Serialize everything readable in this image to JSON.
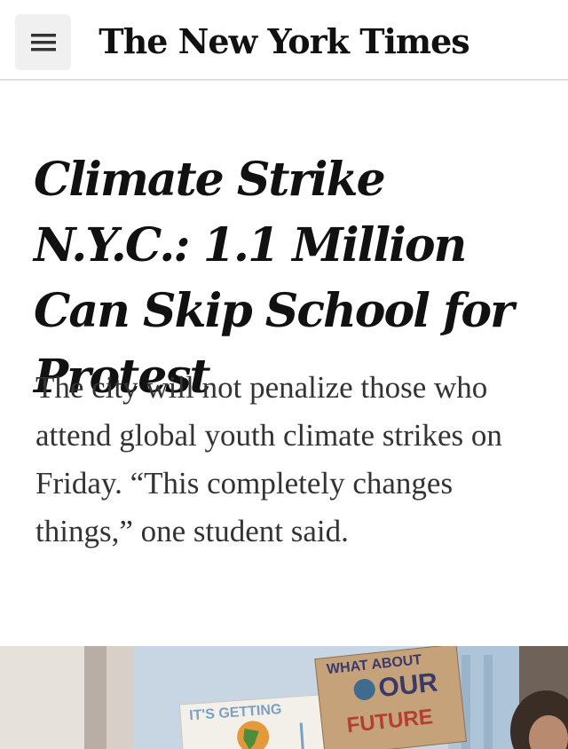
{
  "header": {
    "menu_icon": "hamburger-menu-icon",
    "masthead": "The New York Times"
  },
  "article": {
    "headline": "Climate Strike N.Y.C.: 1.1 Million Can Skip School for Protest",
    "summary": "The city will not penalize those who attend global youth climate strikes on Friday. “This completely changes things,” one student said."
  },
  "photo": {
    "sign_left": "IT'S GETTING",
    "sign_right_line1": "WHAT ABOUT",
    "sign_right_line2": "OUR",
    "sign_right_line3": "FUTURE"
  },
  "colors": {
    "text": "#121212",
    "summary_text": "#333333",
    "menu_bg": "#f0f0f0",
    "divider": "#d3d3d3"
  }
}
